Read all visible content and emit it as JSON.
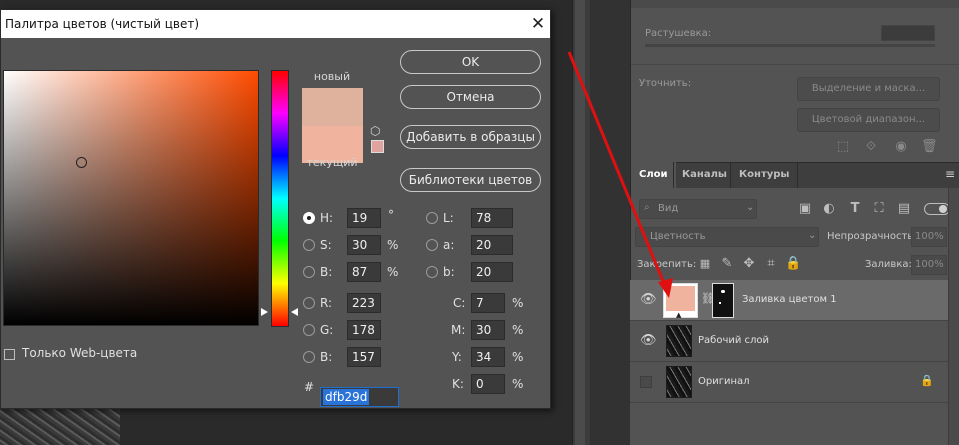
{
  "dialog": {
    "title": "Палитра цветов (чистый цвет)",
    "close": "✕",
    "new_label": "новый",
    "current_label": "текущий",
    "buttons": {
      "ok": "OK",
      "cancel": "Отмена",
      "add_to_swatches": "Добавить в образцы",
      "color_libraries": "Библиотеки цветов"
    },
    "web_only": "Только Web-цвета",
    "colors": {
      "new": "#dfb29d",
      "current": "#f0b39d",
      "small_swatch": "#e0a39d",
      "marker_hue": "#ff4b00"
    },
    "fields": {
      "H": {
        "label": "H:",
        "value": "19",
        "unit": "°"
      },
      "S": {
        "label": "S:",
        "value": "30",
        "unit": "%"
      },
      "B": {
        "label": "B:",
        "value": "87",
        "unit": "%"
      },
      "R": {
        "label": "R:",
        "value": "223"
      },
      "G": {
        "label": "G:",
        "value": "178"
      },
      "Bb": {
        "label": "B:",
        "value": "157"
      },
      "L": {
        "label": "L:",
        "value": "78"
      },
      "a": {
        "label": "a:",
        "value": "20"
      },
      "b": {
        "label": "b:",
        "value": "20"
      },
      "C": {
        "label": "C:",
        "value": "7",
        "unit": "%"
      },
      "M": {
        "label": "M:",
        "value": "30",
        "unit": "%"
      },
      "Y": {
        "label": "Y:",
        "value": "34",
        "unit": "%"
      },
      "K": {
        "label": "K:",
        "value": "0",
        "unit": "%"
      }
    },
    "hex": {
      "label": "#",
      "value": "dfb29d"
    }
  },
  "properties": {
    "feather_label": "Растушевка:",
    "refine_label": "Уточнить:",
    "select_mask_button": "Выделение и маска...",
    "color_range_button": "Цветовой диапазон..."
  },
  "layers_panel": {
    "tabs": [
      "Слои",
      "Каналы",
      "Контуры"
    ],
    "kind_filter": "Вид",
    "blend_mode": "Цветность",
    "opacity_label": "Непрозрачность:",
    "opacity_value": "100%",
    "lock_label": "Закрепить:",
    "fill_label": "Заливка:",
    "fill_value": "100%",
    "layers": [
      {
        "name": "Заливка цветом 1"
      },
      {
        "name": "Рабочий слой"
      },
      {
        "name": "Оригинал"
      }
    ]
  }
}
